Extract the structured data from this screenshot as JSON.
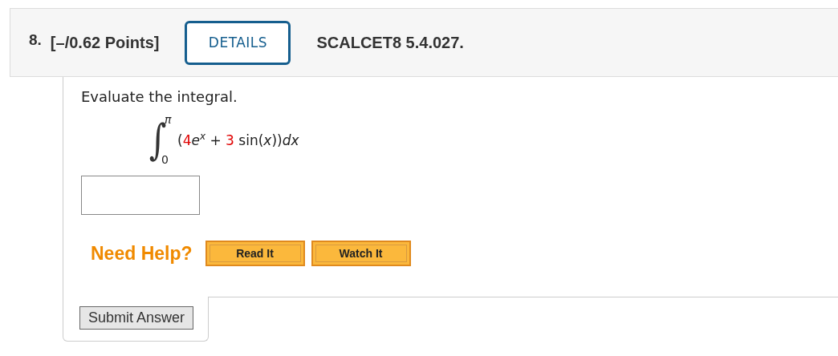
{
  "question": {
    "number": "8.",
    "points": "[–/0.62 Points]",
    "details_button": "DETAILS",
    "reference": "SCALCET8 5.4.027."
  },
  "prompt": "Evaluate the integral.",
  "integral": {
    "sign": "∫",
    "upper": "π",
    "lower": "0",
    "integrand": [
      {
        "kind": "plain",
        "text": "("
      },
      {
        "kind": "number",
        "text": "4"
      },
      {
        "kind": "var",
        "text": "e"
      },
      {
        "kind": "sup",
        "text": "x"
      },
      {
        "kind": "plain",
        "text": " + "
      },
      {
        "kind": "number",
        "text": "3"
      },
      {
        "kind": "plain",
        "text": " sin("
      },
      {
        "kind": "var",
        "text": "x"
      },
      {
        "kind": "plain",
        "text": "))"
      },
      {
        "kind": "var",
        "text": "dx"
      }
    ]
  },
  "help": {
    "label": "Need Help?",
    "buttons": [
      "Read It",
      "Watch It"
    ]
  },
  "submit_button": "Submit Answer"
}
